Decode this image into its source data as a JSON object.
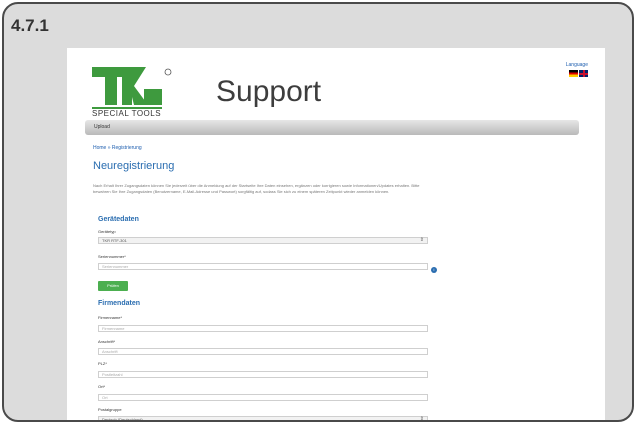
{
  "section_number": "4.7.1",
  "header": {
    "logo_text": "TKR",
    "logo_subtext": "SPECIAL TOOLS",
    "title": "Support",
    "language_link": "Language",
    "languages": [
      "Deutsch",
      "English"
    ]
  },
  "nav": {
    "item": "Upload"
  },
  "breadcrumb": "Home » Registrierung",
  "page_title": "Neuregistrierung",
  "intro": "Nach Erhalt Ihrer Zugangsdaten können Sie jederzeit über die Anmeldung auf der Startseite Ihre Daten einsehen, ergänzen oder korrigieren sowie Informationen/Updates erhalten. Bitte bewahren Sie Ihre Zugangsdaten (Benutzername, E-Mail-Adresse und Passwort) sorgfältig auf, sodass Sie sich zu einem späteren Zeitpunkt wieder anmelden können.",
  "device_section": {
    "title": "Gerätedaten",
    "type_label": "Gerätetyp",
    "type_value": "TKR RTF-301",
    "serial_label": "Seriennummer*",
    "serial_placeholder": "Seriennummer",
    "check_button": "Prüfen"
  },
  "company_section": {
    "title": "Firmendaten",
    "name_label": "Firmenname*",
    "name_placeholder": "Firmenname",
    "address_label": "Anschrift*",
    "address_placeholder": "Anschrift",
    "zip_label": "PLZ*",
    "zip_placeholder": "Postleitzahl",
    "city_label": "Ort*",
    "city_placeholder": "Ort",
    "country_label": "Postalgruppe",
    "country_value": "Deutsch (Deutschland)"
  },
  "colors": {
    "accent": "#2a6db0",
    "button": "#4caf50",
    "logo": "#3e9a3e"
  }
}
